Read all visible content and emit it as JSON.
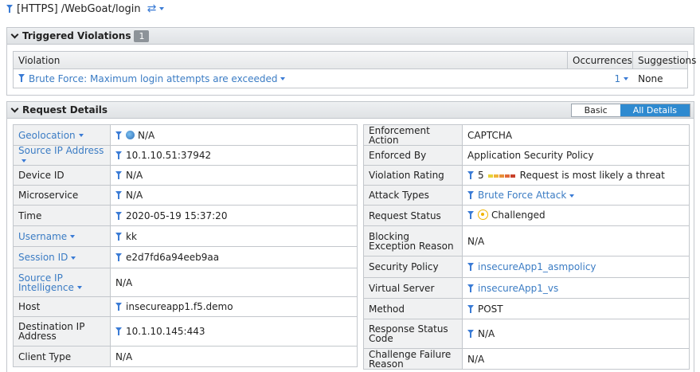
{
  "topbar": {
    "title": "[HTTPS] /WebGoat/login"
  },
  "violations": {
    "title": "Triggered Violations",
    "count": "1",
    "headers": {
      "violation": "Violation",
      "occurrences": "Occurrences",
      "suggestions": "Suggestions"
    },
    "rows": [
      {
        "violation": "Brute Force: Maximum login attempts are exceeded",
        "occurrences": "1",
        "suggestions": "None"
      }
    ]
  },
  "request": {
    "title": "Request Details",
    "toggle": {
      "basic": "Basic",
      "all": "All Details"
    },
    "left": [
      {
        "label": "Geolocation",
        "value": "N/A"
      },
      {
        "label": "Source IP Address",
        "value": "10.1.10.51:37942"
      },
      {
        "label": "Device ID",
        "value": "N/A"
      },
      {
        "label": "Microservice",
        "value": "N/A"
      },
      {
        "label": "Time",
        "value": "2020-05-19 15:37:20"
      },
      {
        "label": "Username",
        "value": "kk"
      },
      {
        "label": "Session ID",
        "value": "e2d7fd6a94eeb9aa"
      },
      {
        "label": "Source IP Intelligence",
        "value": "N/A"
      },
      {
        "label": "Host",
        "value": "insecureapp1.f5.demo"
      },
      {
        "label": "Destination IP Address",
        "value": "10.1.10.145:443"
      },
      {
        "label": "Client Type",
        "value": "N/A"
      }
    ],
    "right": [
      {
        "label": "Enforcement Action",
        "value": "CAPTCHA"
      },
      {
        "label": "Enforced By",
        "value": "Application Security Policy"
      },
      {
        "label": "Violation Rating",
        "value": "5",
        "extra": "Request is most likely a threat"
      },
      {
        "label": "Attack Types",
        "value": "Brute Force Attack"
      },
      {
        "label": "Request Status",
        "value": "Challenged"
      },
      {
        "label": "Blocking Exception Reason",
        "value": "N/A"
      },
      {
        "label": "Security Policy",
        "value": "insecureApp1_asmpolicy"
      },
      {
        "label": "Virtual Server",
        "value": "insecureApp1_vs"
      },
      {
        "label": "Method",
        "value": "POST"
      },
      {
        "label": "Response Status Code",
        "value": "N/A"
      },
      {
        "label": "Challenge Failure Reason",
        "value": "N/A"
      }
    ]
  },
  "colors": {
    "link": "#3b7cc4",
    "accent": "#2e8ad0",
    "rating": [
      "#e8d23a",
      "#f0b43a",
      "#e8903a",
      "#e0683a",
      "#c8402a"
    ]
  },
  "icons": [
    "filter-icon",
    "caret-down-icon",
    "swap-icon",
    "chevron-down-icon",
    "globe-icon",
    "challenge-icon"
  ]
}
